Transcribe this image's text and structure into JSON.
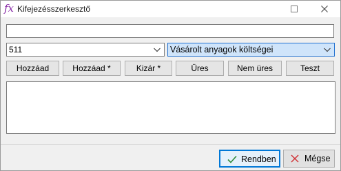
{
  "window": {
    "title": "Kifejezésszerkesztő",
    "icon_glyph": "fx",
    "icon": "function-icon",
    "maximize_icon": "maximize-icon",
    "close_icon": "close-icon"
  },
  "expression": {
    "value": ""
  },
  "combos": {
    "left": {
      "value": "511"
    },
    "right": {
      "value": "Vásárolt anyagok költségei"
    }
  },
  "buttons": [
    {
      "key": "H",
      "rest": "ozzáad"
    },
    {
      "key": "o",
      "pre": "H",
      "rest": "zzáad *"
    },
    {
      "key": "K",
      "rest": "izár *"
    },
    {
      "key": "Ü",
      "rest": "res"
    },
    {
      "key": "N",
      "rest": "em üres"
    },
    {
      "key": "T",
      "rest": "eszt"
    }
  ],
  "footer": {
    "ok_label": "Rendben",
    "cancel_label": "Mégse"
  },
  "colors": {
    "accent": "#0078d7",
    "icon_purple": "#8a2da8",
    "ok_check": "#2e8b3a",
    "cancel_x": "#d13438",
    "selection_bg": "#cfe4fa"
  }
}
